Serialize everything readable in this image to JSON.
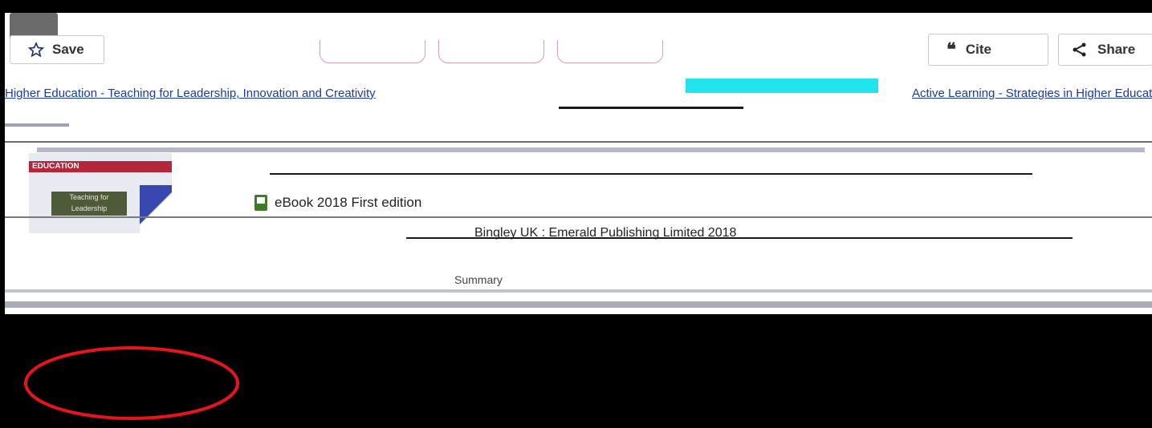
{
  "toolbar": {
    "save_label": "Save",
    "cite_label": "Cite",
    "share_label": "Share"
  },
  "breadcrumbs": {
    "left": "Higher Education - Teaching for Leadership, Innovation and Creativity",
    "right": "Active Learning - Strategies in Higher Education"
  },
  "record": {
    "cover_series": "EDUCATION",
    "cover_title": "Teaching for Leadership",
    "format": "eBook 2018 First edition",
    "publisher": "Bingley UK : Emerald Publishing Limited 2018",
    "summary_prefix": "Summary"
  },
  "colors": {
    "highlight": "#22e4ee",
    "link": "#1a3aa6",
    "annotation": "#e8141c"
  },
  "icons": {
    "save": "star-outline-icon",
    "cite": "quote-icon",
    "share": "share-icon",
    "format": "ebook-icon"
  }
}
